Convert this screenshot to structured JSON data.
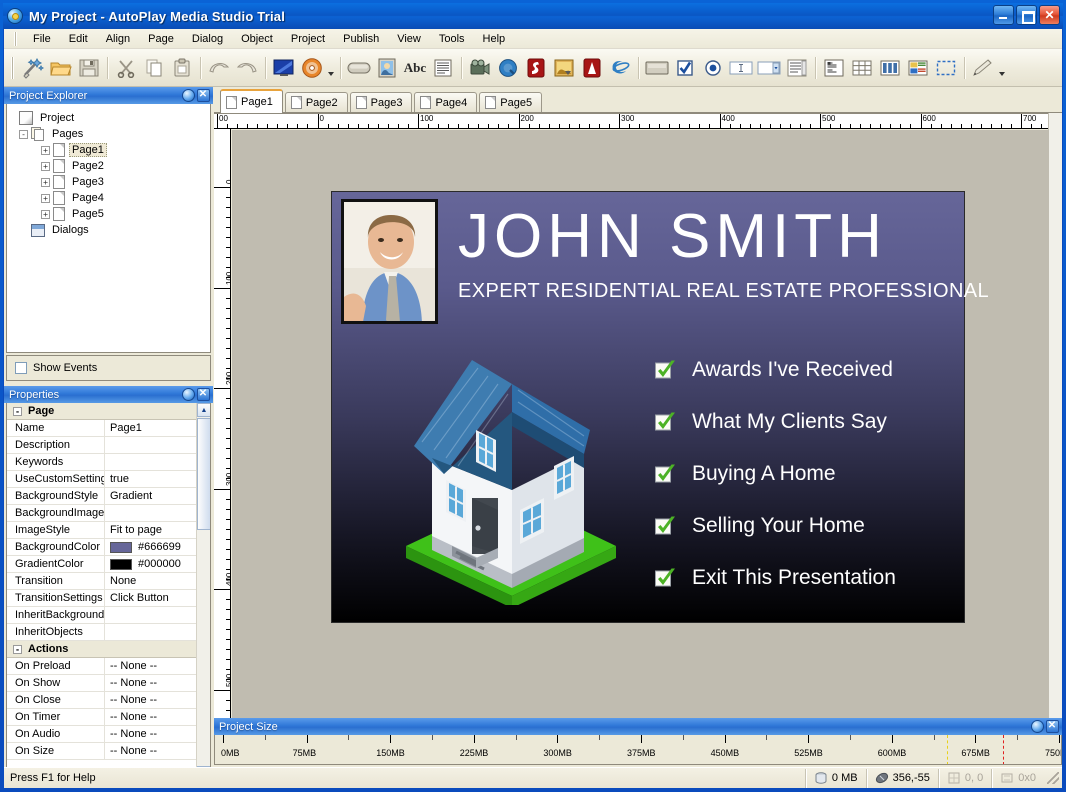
{
  "window": {
    "title": "My Project - AutoPlay Media Studio Trial",
    "icon": "cd-disc-icon",
    "minimize_label": "Minimize",
    "maximize_label": "Maximize",
    "close_label": "Close"
  },
  "menubar": {
    "items": [
      "File",
      "Edit",
      "Align",
      "Page",
      "Dialog",
      "Object",
      "Project",
      "Publish",
      "View",
      "Tools",
      "Help"
    ]
  },
  "toolbar": {
    "groups": [
      {
        "buttons": [
          {
            "name": "new-project-icon",
            "tip": "New Project"
          },
          {
            "name": "open-folder-icon",
            "tip": "Open"
          },
          {
            "name": "save-disk-icon",
            "tip": "Save"
          }
        ]
      },
      {
        "buttons": [
          {
            "name": "cut-scissors-icon",
            "tip": "Cut"
          },
          {
            "name": "copy-icon",
            "tip": "Copy"
          },
          {
            "name": "paste-clipboard-icon",
            "tip": "Paste"
          }
        ]
      },
      {
        "buttons": [
          {
            "name": "undo-arrow-icon",
            "tip": "Undo"
          },
          {
            "name": "redo-arrow-icon",
            "tip": "Redo"
          }
        ]
      },
      {
        "buttons": [
          {
            "name": "preview-monitor-icon",
            "tip": "Preview"
          },
          {
            "name": "build-cd-icon",
            "tip": "Build / Burn"
          }
        ]
      },
      {
        "buttons": [
          {
            "name": "button-object-icon",
            "tip": "Button Object"
          },
          {
            "name": "image-object-icon",
            "tip": "Image Object"
          },
          {
            "name": "text-object-icon",
            "tip": "Text Object",
            "label": "Abc"
          },
          {
            "name": "paragraph-object-icon",
            "tip": "Paragraph Object"
          }
        ]
      },
      {
        "buttons": [
          {
            "name": "video-object-icon",
            "tip": "Video Object"
          },
          {
            "name": "quicktime-object-icon",
            "tip": "QuickTime Object"
          },
          {
            "name": "flash-object-icon",
            "tip": "Flash Object"
          },
          {
            "name": "slideshow-object-icon",
            "tip": "Slideshow Object"
          },
          {
            "name": "pdf-object-icon",
            "tip": "PDF Object"
          },
          {
            "name": "web-browser-object-icon",
            "tip": "Web Object"
          }
        ]
      },
      {
        "buttons": [
          {
            "name": "panel-object-icon",
            "tip": "Panel"
          },
          {
            "name": "checkbox-object-icon",
            "tip": "Checkbox"
          },
          {
            "name": "radio-button-object-icon",
            "tip": "Radio Button"
          },
          {
            "name": "input-field-object-icon",
            "tip": "Input"
          },
          {
            "name": "combobox-object-icon",
            "tip": "Combo Box"
          },
          {
            "name": "listbox-object-icon",
            "tip": "List Box"
          }
        ]
      },
      {
        "buttons": [
          {
            "name": "richtext-object-icon",
            "tip": "Rich Text"
          },
          {
            "name": "grid-object-icon",
            "tip": "Grid"
          },
          {
            "name": "tree-object-icon",
            "tip": "Tree"
          },
          {
            "name": "listview-object-icon",
            "tip": "List View"
          },
          {
            "name": "select-region-icon",
            "tip": "Select Region"
          }
        ]
      },
      {
        "buttons": [
          {
            "name": "pencil-edit-icon",
            "tip": "Edit"
          }
        ]
      }
    ]
  },
  "project_explorer": {
    "title": "Project Explorer",
    "tree": {
      "root_label": "Project",
      "pages_label": "Pages",
      "pages": [
        "Page1",
        "Page2",
        "Page3",
        "Page4",
        "Page5"
      ],
      "selected_page": "Page1",
      "dialogs_label": "Dialogs",
      "expander_expanded": "-",
      "expander_collapsed": "+"
    },
    "show_events_label": "Show Events",
    "show_events_checked": false
  },
  "properties": {
    "title": "Properties",
    "sections": [
      {
        "name": "Page",
        "expanded": true,
        "rows": [
          {
            "name": "Name",
            "value": "Page1"
          },
          {
            "name": "Description",
            "value": ""
          },
          {
            "name": "Keywords",
            "value": ""
          },
          {
            "name": "UseCustomSettings",
            "value": "true"
          },
          {
            "name": "BackgroundStyle",
            "value": "Gradient"
          },
          {
            "name": "BackgroundImage",
            "value": ""
          },
          {
            "name": "ImageStyle",
            "value": "Fit to page"
          },
          {
            "name": "BackgroundColor",
            "value": "#666699",
            "swatch": "#666699"
          },
          {
            "name": "GradientColor",
            "value": "#000000",
            "swatch": "#000000"
          },
          {
            "name": "Transition",
            "value": "None"
          },
          {
            "name": "TransitionSettings",
            "value": "Click Button"
          },
          {
            "name": "InheritBackground",
            "value": ""
          },
          {
            "name": "InheritObjects",
            "value": ""
          }
        ]
      },
      {
        "name": "Actions",
        "expanded": true,
        "rows": [
          {
            "name": "On Preload",
            "value": "-- None --"
          },
          {
            "name": "On Show",
            "value": "-- None --"
          },
          {
            "name": "On Close",
            "value": "-- None --"
          },
          {
            "name": "On Timer",
            "value": "-- None --"
          },
          {
            "name": "On Audio",
            "value": "-- None --"
          },
          {
            "name": "On Size",
            "value": "-- None --"
          }
        ]
      }
    ]
  },
  "page_tabs": {
    "tabs": [
      "Page1",
      "Page2",
      "Page3",
      "Page4",
      "Page5"
    ],
    "active": "Page1"
  },
  "rulers": {
    "horizontal": [
      "00",
      "0",
      "100",
      "200",
      "300",
      "400",
      "500",
      "600",
      "700"
    ],
    "vertical": [
      "0",
      "100",
      "200",
      "300",
      "400",
      "500"
    ]
  },
  "canvas": {
    "page_background_top": "#666699",
    "page_background_bottom": "#000000",
    "header": {
      "name": "JOHN SMITH",
      "subtitle": "EXPERT RESIDENTIAL REAL ESTATE PROFESSIONAL",
      "photo_alt": "portrait-photo"
    },
    "menu_items": [
      "Awards I've Received",
      "What My Clients Say",
      "Buying A Home",
      "Selling Your Home",
      "Exit This Presentation"
    ],
    "check_color": "#4cb225",
    "house_graphic": {
      "roof_color": "#2f6ea8",
      "wall_color": "#f2f4f6",
      "lawn_color": "#3fc119"
    }
  },
  "project_size": {
    "title": "Project Size",
    "labels": [
      "0MB",
      "75MB",
      "150MB",
      "225MB",
      "300MB",
      "375MB",
      "450MB",
      "525MB",
      "600MB",
      "675MB",
      "750MB"
    ],
    "warn_marker_label": "650MB",
    "warn_marker_color": "#e8d11a",
    "limit_marker_label": "700MB",
    "limit_marker_color": "#e02020"
  },
  "statusbar": {
    "hint": "Press F1 for Help",
    "size": "0 MB",
    "cursor": "356,-55",
    "position": "0, 0",
    "dimensions": "0x0"
  }
}
